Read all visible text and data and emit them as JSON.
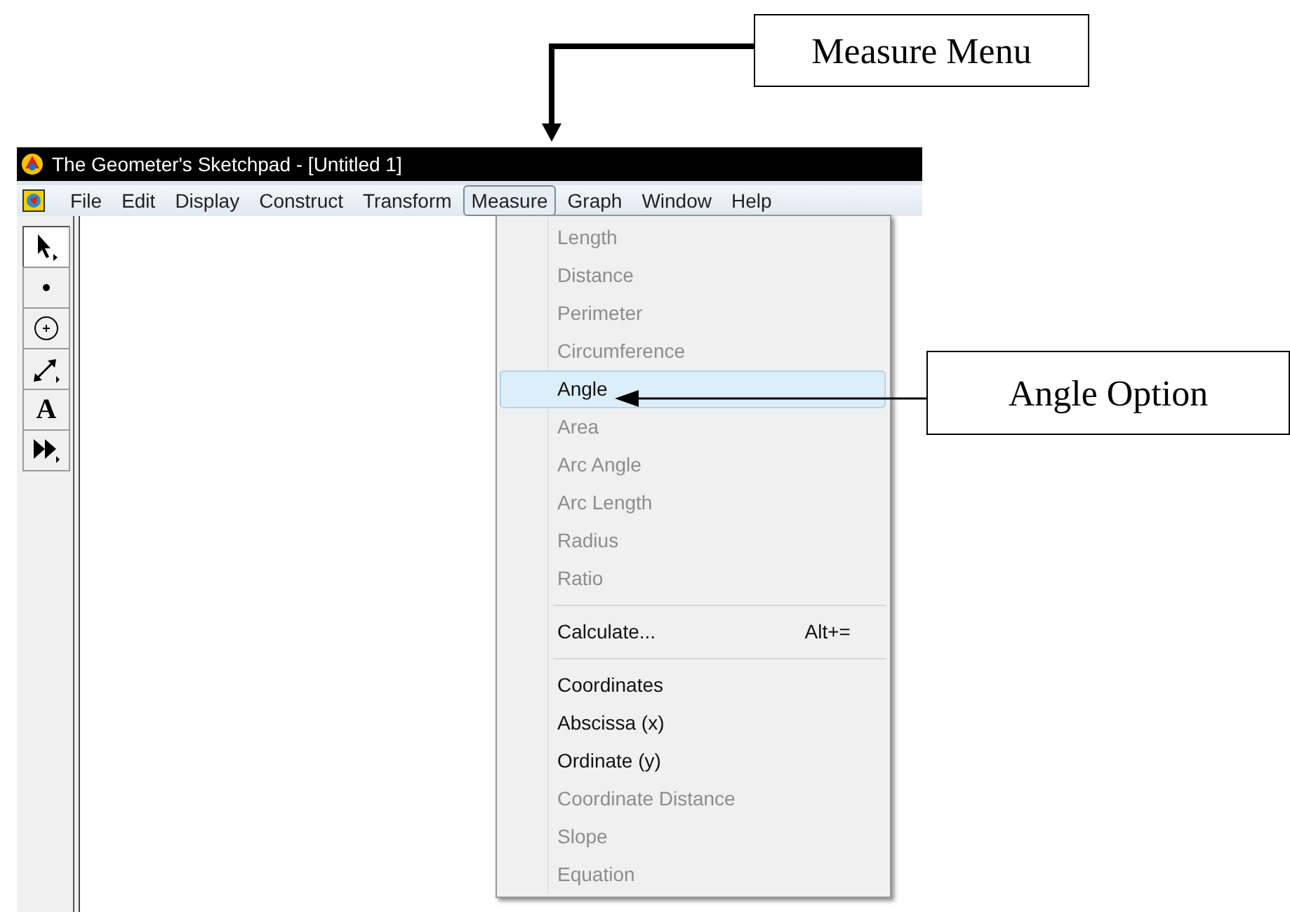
{
  "callouts": [
    {
      "kind": "menu",
      "text": "Measure Menu"
    },
    {
      "kind": "option",
      "text": "Angle Option"
    }
  ],
  "window": {
    "title": "The Geometer's Sketchpad - [Untitled 1]"
  },
  "menu_bar": [
    {
      "label": "File",
      "selected": false
    },
    {
      "label": "Edit",
      "selected": false
    },
    {
      "label": "Display",
      "selected": false
    },
    {
      "label": "Construct",
      "selected": false
    },
    {
      "label": "Transform",
      "selected": false
    },
    {
      "label": "Measure",
      "selected": true
    },
    {
      "label": "Graph",
      "selected": false
    },
    {
      "label": "Window",
      "selected": false
    },
    {
      "label": "Help",
      "selected": false
    }
  ],
  "toolbar": [
    {
      "kind": "arrow",
      "selected": true
    },
    {
      "kind": "point",
      "selected": false
    },
    {
      "kind": "compass",
      "selected": false
    },
    {
      "kind": "line",
      "selected": false
    },
    {
      "kind": "text",
      "label": "A",
      "selected": false
    },
    {
      "kind": "custom",
      "selected": false
    }
  ],
  "measure_menu": {
    "groups": [
      [
        {
          "label": "Length",
          "disabled": true,
          "selected": false
        },
        {
          "label": "Distance",
          "disabled": true,
          "selected": false
        },
        {
          "label": "Perimeter",
          "disabled": true,
          "selected": false
        },
        {
          "label": "Circumference",
          "disabled": true,
          "selected": false
        },
        {
          "label": "Angle",
          "disabled": false,
          "selected": true
        },
        {
          "label": "Area",
          "disabled": true,
          "selected": false
        },
        {
          "label": "Arc Angle",
          "disabled": true,
          "selected": false
        },
        {
          "label": "Arc Length",
          "disabled": true,
          "selected": false
        },
        {
          "label": "Radius",
          "disabled": true,
          "selected": false
        },
        {
          "label": "Ratio",
          "disabled": true,
          "selected": false
        }
      ],
      [
        {
          "label": "Calculate...",
          "shortcut": "Alt+=",
          "disabled": false,
          "selected": false
        }
      ],
      [
        {
          "label": "Coordinates",
          "disabled": false,
          "selected": false
        },
        {
          "label": "Abscissa (x)",
          "disabled": false,
          "selected": false
        },
        {
          "label": "Ordinate (y)",
          "disabled": false,
          "selected": false
        },
        {
          "label": "Coordinate Distance",
          "disabled": true,
          "selected": false
        },
        {
          "label": "Slope",
          "disabled": true,
          "selected": false
        },
        {
          "label": "Equation",
          "disabled": true,
          "selected": false
        }
      ]
    ]
  }
}
